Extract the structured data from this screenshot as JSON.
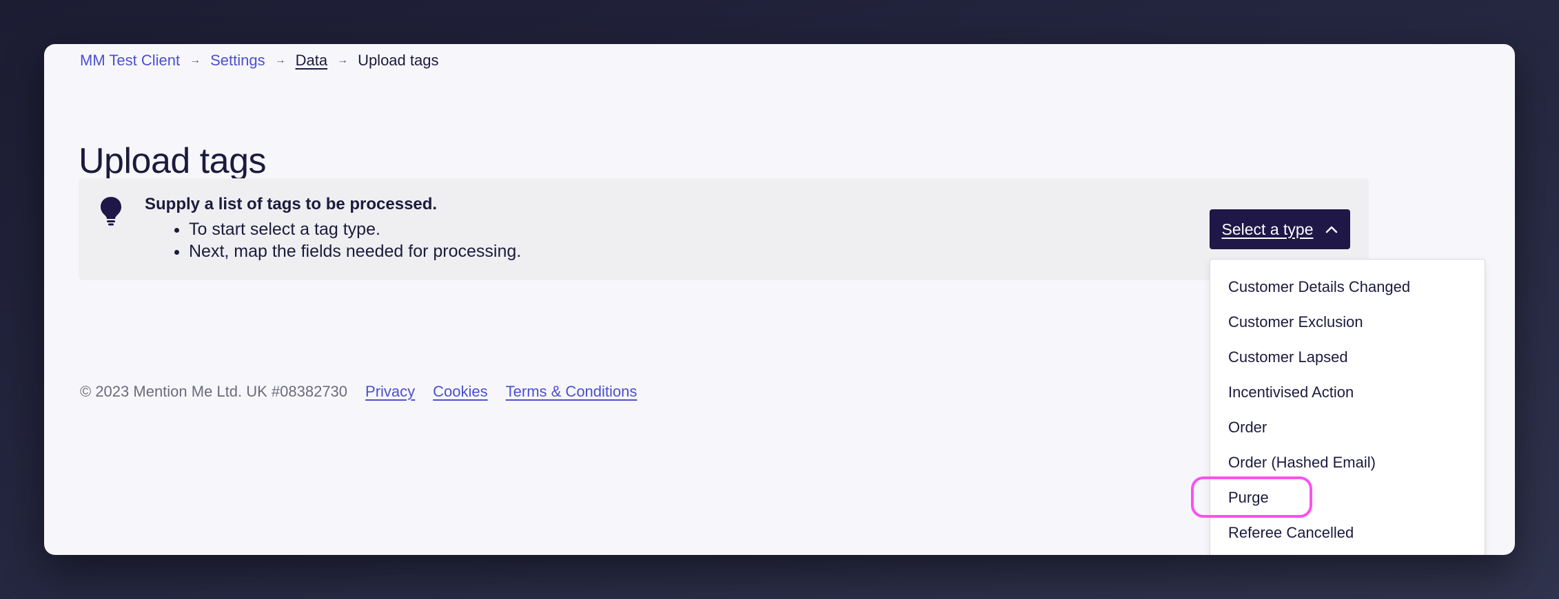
{
  "breadcrumb": {
    "items": [
      {
        "label": "MM Test Client"
      },
      {
        "label": "Settings"
      },
      {
        "label": "Data"
      },
      {
        "label": "Upload tags"
      }
    ],
    "separator": "→"
  },
  "page": {
    "title": "Upload tags"
  },
  "info": {
    "icon": "lightbulb-icon",
    "heading": "Supply a list of tags to be processed.",
    "bullets": [
      "To start select a tag type.",
      "Next, map the fields needed for processing."
    ]
  },
  "type_select": {
    "label": "Select a type",
    "icon": "chevron-up-icon",
    "expanded": true,
    "options": [
      "Customer Details Changed",
      "Customer Exclusion",
      "Customer Lapsed",
      "Incentivised Action",
      "Order",
      "Order (Hashed Email)",
      "Purge",
      "Referee Cancelled"
    ],
    "highlighted_option": "Purge"
  },
  "footer": {
    "copyright": "© 2023 Mention Me Ltd. UK #08382730",
    "links": [
      "Privacy",
      "Cookies",
      "Terms & Conditions"
    ]
  },
  "colors": {
    "background": "#262842",
    "panel": "#f7f7fb",
    "primary_button": "#1e1747",
    "link": "#4b4fcf",
    "highlight": "#ff4ff0"
  }
}
